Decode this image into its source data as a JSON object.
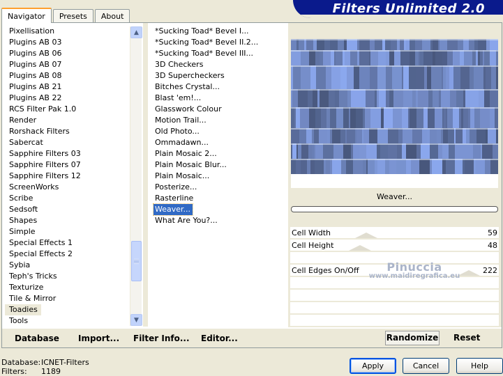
{
  "tabs": [
    {
      "label": "Navigator",
      "active": true
    },
    {
      "label": "Presets",
      "active": false
    },
    {
      "label": "About",
      "active": false
    }
  ],
  "app_title": "Filters Unlimited 2.0",
  "categories": [
    "Pixellisation",
    "Plugins AB 03",
    "Plugins AB 06",
    "Plugins AB 07",
    "Plugins AB 08",
    "Plugins AB 21",
    "Plugins AB 22",
    "RCS Filter Pak 1.0",
    "Render",
    "Rorshack Filters",
    "Sabercat",
    "Sapphire Filters 03",
    "Sapphire Filters 07",
    "Sapphire Filters 12",
    "ScreenWorks",
    "Scribe",
    "Sedsoft",
    "Shapes",
    "Simple",
    "Special Effects 1",
    "Special Effects 2",
    "Sybia",
    "Teph's Tricks",
    "Texturize",
    "Tile & Mirror",
    "Toadies",
    "Tools"
  ],
  "selected_category": "Toadies",
  "filters": [
    "*Sucking Toad*  Bevel I...",
    "*Sucking Toad*  Bevel II.2...",
    "*Sucking Toad*  Bevel III...",
    "3D Checkers",
    "3D Supercheckers",
    "Bitches Crystal...",
    "Blast 'em!...",
    "Glasswork Colour",
    "Motion Trail...",
    "Old Photo...",
    "Ommadawn...",
    "Plain Mosaic 2...",
    "Plain Mosaic Blur...",
    "Plain Mosaic...",
    "Posterize...",
    "Rasterline",
    "Weaver...",
    "What Are You?..."
  ],
  "selected_filter": "Weaver...",
  "filter_name_display": "Weaver...",
  "progress": 0,
  "params": [
    {
      "label": "Cell Width",
      "value": "59",
      "level": 0.23
    },
    {
      "label": "Cell Height",
      "value": "48",
      "level": 0.19
    },
    {
      "label": "",
      "value": "",
      "level": null
    },
    {
      "label": "Cell Edges On/Off",
      "value": "222",
      "level": 0.87
    },
    {
      "label": "",
      "value": "",
      "level": null
    },
    {
      "label": "",
      "value": "",
      "level": null
    },
    {
      "label": "",
      "value": "",
      "level": null
    },
    {
      "label": "",
      "value": "",
      "level": null
    }
  ],
  "watermark": {
    "name": "Pinuccia",
    "url": "www.maidiregrafica.eu"
  },
  "bottom_links": {
    "database": "Database",
    "import": "Import...",
    "filter_info": "Filter Info...",
    "editor": "Editor...",
    "randomize": "Randomize",
    "reset": "Reset"
  },
  "status": {
    "database_label": "Database:",
    "database_value": "ICNET-Filters",
    "filters_label": "Filters:",
    "filters_value": "1189"
  },
  "buttons": {
    "apply": "Apply",
    "cancel": "Cancel",
    "help": "Help"
  },
  "colors": {
    "selection": "#316ac5",
    "banner": "#0a1a8c",
    "preview_base": "#6e87b8"
  }
}
